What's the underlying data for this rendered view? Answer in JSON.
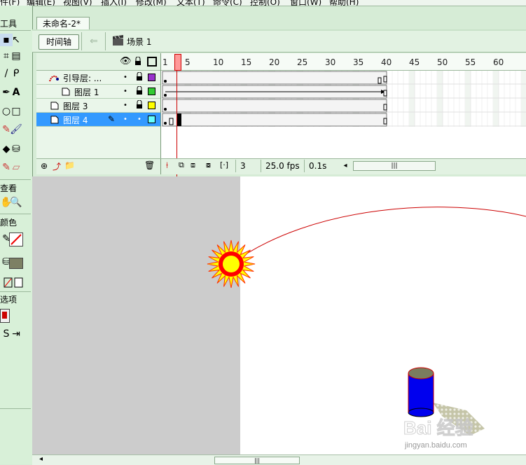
{
  "menu": [
    "件(F)",
    "编辑(E)",
    "视图(V)",
    "插入(I)",
    "修改(M)",
    "文本(T)",
    "命令(C)",
    "控制(O)",
    "窗口(W)",
    "帮助(H)"
  ],
  "toolbox": {
    "title": "工具",
    "view_label": "查看",
    "color_label": "颜色",
    "options_label": "选项"
  },
  "document": {
    "tab_title": "未命名-2*"
  },
  "timeline": {
    "timeline_button": "时间轴",
    "scene": "场景 1",
    "ruler_labels": [
      "1",
      "5",
      "10",
      "15",
      "20",
      "25",
      "30",
      "35",
      "40",
      "45",
      "50",
      "55",
      "60"
    ],
    "layers": [
      {
        "name": "引导层: ...",
        "type": "guide",
        "color": "#9933cc"
      },
      {
        "name": "图层 1",
        "type": "guided",
        "color": "#33cc33"
      },
      {
        "name": "图层 3",
        "type": "normal",
        "color": "#ffff00"
      },
      {
        "name": "图层 4",
        "type": "normal",
        "color": "#66ffff",
        "selected": true
      }
    ],
    "current_frame": "3",
    "frame_rate": "25.0 fps",
    "elapsed_time": "0.1s"
  },
  "colors": {
    "playhead": "#cc0000",
    "selected_layer": "#3399ff",
    "motion_path": "#cc0000",
    "sun_core": "#ffff00",
    "sun_ring": "#ff0000",
    "cylinder": "#0000ee"
  },
  "watermark": {
    "text": "Bai 经验",
    "url": "jingyan.baidu.com"
  }
}
